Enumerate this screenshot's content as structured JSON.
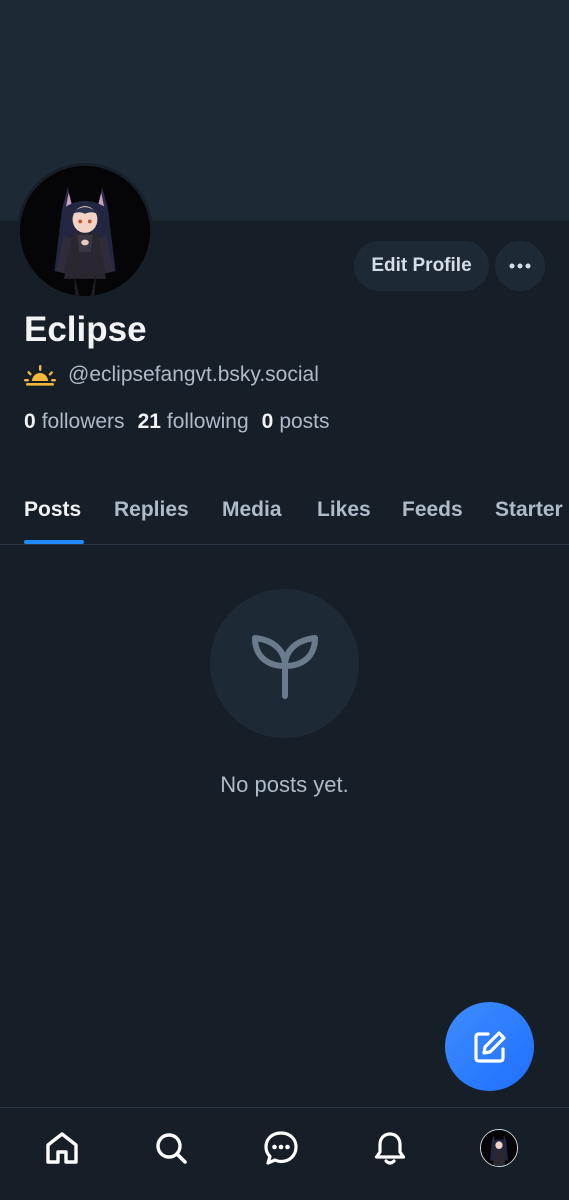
{
  "profile": {
    "display_name": "Eclipse",
    "handle": "@eclipsefangvt.bsky.social",
    "status_emoji": "sunrise-icon",
    "edit_label": "Edit Profile"
  },
  "stats": {
    "followers_count": "0",
    "followers_label": "followers",
    "following_count": "21",
    "following_label": "following",
    "posts_count": "0",
    "posts_label": "posts"
  },
  "tabs": [
    {
      "label": "Posts",
      "active": true
    },
    {
      "label": "Replies"
    },
    {
      "label": "Media"
    },
    {
      "label": "Likes"
    },
    {
      "label": "Feeds"
    },
    {
      "label": "Starter"
    }
  ],
  "empty_state": {
    "icon": "sprout-icon",
    "text": "No posts yet."
  },
  "nav": [
    "home-icon",
    "search-icon",
    "chat-icon",
    "bell-icon",
    "profile-avatar"
  ],
  "colors": {
    "background": "#161e27",
    "banner": "#1e2936",
    "accent": "#208bfe",
    "fab": "#2a7bff",
    "muted_text": "#aebbc9"
  }
}
